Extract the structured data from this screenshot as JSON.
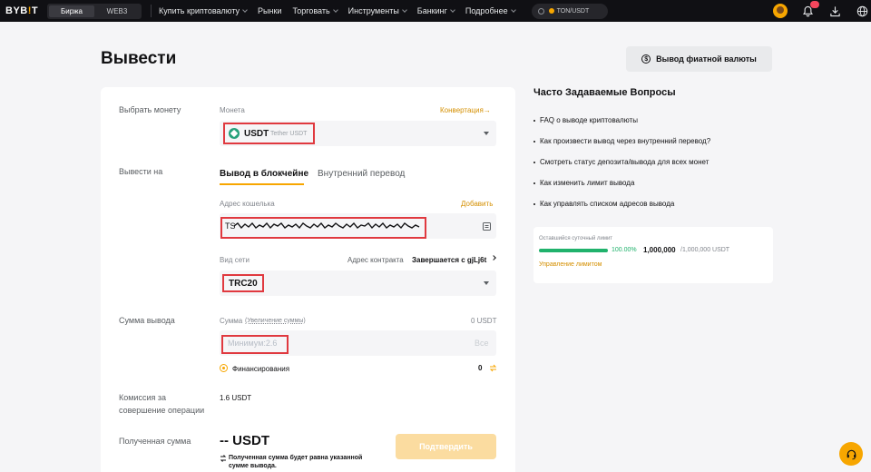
{
  "nav": {
    "logo_main": "BYB",
    "logo_bang": "!",
    "logo_end": "T",
    "seg_exchange": "Биржа",
    "seg_web3": "WEB3",
    "items": [
      {
        "label": "Купить криптовалюту",
        "dropdown": true
      },
      {
        "label": "Рынки",
        "dropdown": false
      },
      {
        "label": "Торговать",
        "dropdown": true
      },
      {
        "label": "Инструменты",
        "dropdown": true
      },
      {
        "label": "Банкинг",
        "dropdown": true
      },
      {
        "label": "Подробнее",
        "dropdown": true
      }
    ],
    "search_text": "TON/USDT"
  },
  "page": {
    "title": "Вывести",
    "fiat_button": "Вывод фиатной валюты"
  },
  "form": {
    "coin_label": "Выбрать монету",
    "coin_small": "Монета",
    "convert_link": "Конвертация→",
    "coin_symbol": "USDT",
    "coin_name": "Tether USDT",
    "to_label": "Вывести на",
    "tab_chain": "Вывод в блокчейне",
    "tab_internal": "Внутренний перевод",
    "address_label": "Адрес кошелька",
    "add_link": "Добавить",
    "address_value": "TS",
    "network_label": "Вид сети",
    "contract_label": "Адрес контракта",
    "contract_value": "Завершается с gjLj6t",
    "network_value": "TRC20",
    "amount_label": "Сумма вывода",
    "amount_small": "Сумма",
    "amount_increase": "(Увеличение суммы)",
    "amount_balance": "0 USDT",
    "amount_placeholder": "Минимум:2.6",
    "amount_all": "Все",
    "funding_label": "Финансирования",
    "funding_value": "0",
    "fee_label_1": "Комиссия за",
    "fee_label_2": "совершение операции",
    "fee_value": "1.6 USDT",
    "received_label": "Полученная сумма",
    "received_value": "-- USDT",
    "received_note_1": "Полученная сумма будет равна указанной",
    "received_note_2": "сумме вывода.",
    "confirm_button": "Подтвердить"
  },
  "faq": {
    "title": "Часто Задаваемые Вопросы",
    "items": [
      "FAQ о выводе криптовалюты",
      "Как произвести вывод через внутренний перевод?",
      "Смотреть статус депозита/вывода для всех монет",
      "Как изменить лимит вывода",
      "Как управлять списком адресов вывода"
    ]
  },
  "limit": {
    "label": "Оставшийся суточный лимит",
    "percent": "100.00%",
    "percent_fraction": 1.0,
    "remaining": "1,000,000",
    "total": "/1,000,000 USDT",
    "manage_link": "Управление лимитом"
  },
  "colors": {
    "accent": "#f7a600",
    "highlight_box": "#e0393f",
    "success": "#20b26c"
  }
}
